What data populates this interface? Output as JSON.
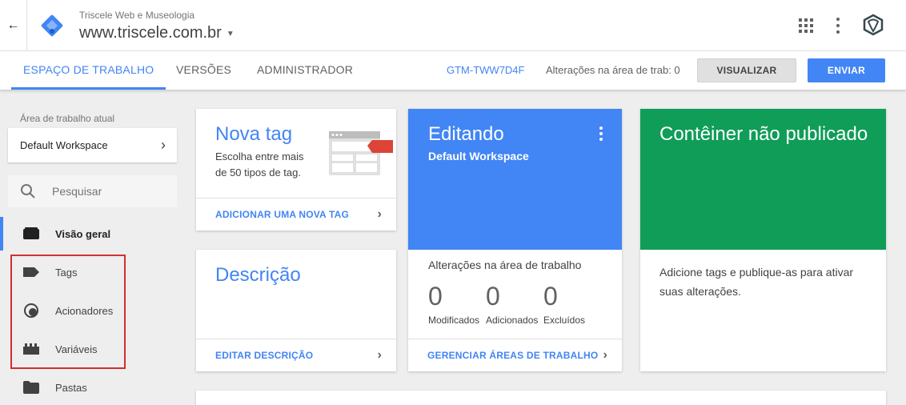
{
  "header": {
    "account": "Triscele Web e Museologia",
    "container": "www.triscele.com.br"
  },
  "tabs": [
    {
      "label": "ESPAÇO DE TRABALHO"
    },
    {
      "label": "VERSÕES"
    },
    {
      "label": "ADMINISTRADOR"
    }
  ],
  "toolbar": {
    "container_id": "GTM-TWW7D4F",
    "changes": "Alterações na área de trab: 0",
    "preview_label": "VISUALIZAR",
    "submit_label": "ENVIAR"
  },
  "sidebar": {
    "workspace_label": "Área de trabalho atual",
    "workspace_name": "Default Workspace",
    "search_placeholder": "Pesquisar",
    "items": [
      {
        "label": "Visão geral",
        "icon": "overview-icon"
      },
      {
        "label": "Tags",
        "icon": "tag-icon"
      },
      {
        "label": "Acionadores",
        "icon": "trigger-icon"
      },
      {
        "label": "Variáveis",
        "icon": "variable-icon"
      },
      {
        "label": "Pastas",
        "icon": "folder-icon"
      }
    ]
  },
  "cards": {
    "new_tag": {
      "title": "Nova tag",
      "desc_line1": "Escolha entre mais",
      "desc_line2": "de 50 tipos de tag.",
      "action": "ADICIONAR UMA NOVA TAG"
    },
    "description": {
      "title": "Descrição",
      "action": "EDITAR DESCRIÇÃO"
    },
    "editing": {
      "title": "Editando",
      "subtitle": "Default Workspace",
      "changes_label": "Alterações na área de trabalho",
      "stats": [
        {
          "value": "0",
          "label": "Modificados"
        },
        {
          "value": "0",
          "label": "Adicionados"
        },
        {
          "value": "0",
          "label": "Excluídos"
        }
      ],
      "action": "GERENCIAR ÁREAS DE TRABALHO"
    },
    "unpublished": {
      "title": "Contêiner não publicado",
      "desc_line1": "Adicione tags e publique-as para ativar",
      "desc_line2": "suas alterações."
    }
  },
  "colors": {
    "accent": "#4285f4",
    "green": "#0f9d58",
    "highlight": "#d32f2f"
  }
}
